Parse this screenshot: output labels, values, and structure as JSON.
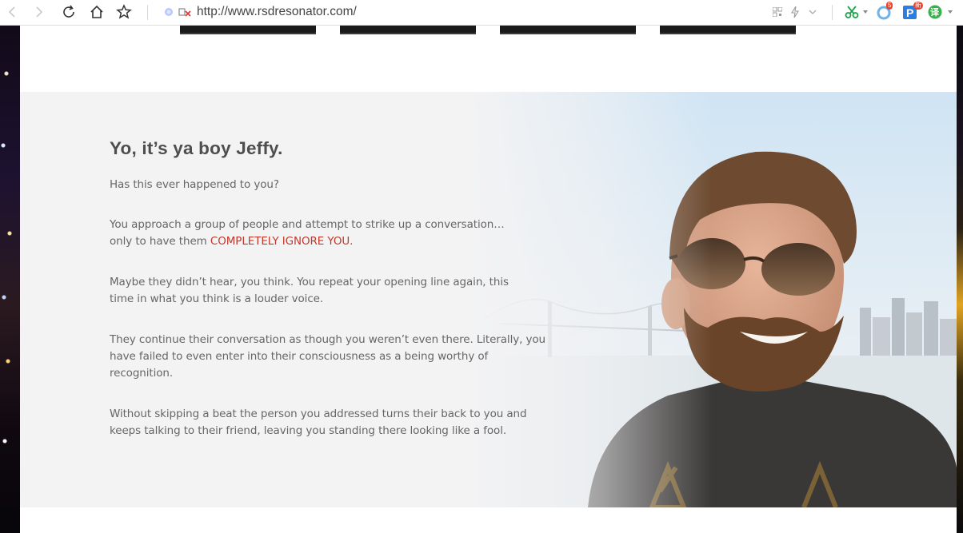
{
  "browser": {
    "url": "http://www.rsdresonator.com/",
    "notification_count": "5",
    "extension_badge": "新",
    "translate_label": "译"
  },
  "article": {
    "heading": "Yo, it’s ya boy Jeffy.",
    "p1": "Has this ever happened to you?",
    "p2_start": "You approach a group of people and attempt to strike up a conversation…",
    "p2_line2": "only to have them ",
    "p2_emphasis": "COMPLETELY IGNORE YOU.",
    "p3": "Maybe they didn’t hear, you think. You repeat your opening line again, this time in what you think is a louder voice.",
    "p4": "They continue their conversation as though you weren’t even there. Literally, you have failed to even enter into their consciousness as a being worthy of recognition.",
    "p5": "Without skipping a beat the person you addressed turns their back to you and keeps talking to their friend, leaving you standing there looking like a fool."
  },
  "colors": {
    "emphasis": "#c0392b",
    "heading": "#4e4e4e",
    "body_text": "#666666",
    "section_bg": "#f3f3f4"
  }
}
